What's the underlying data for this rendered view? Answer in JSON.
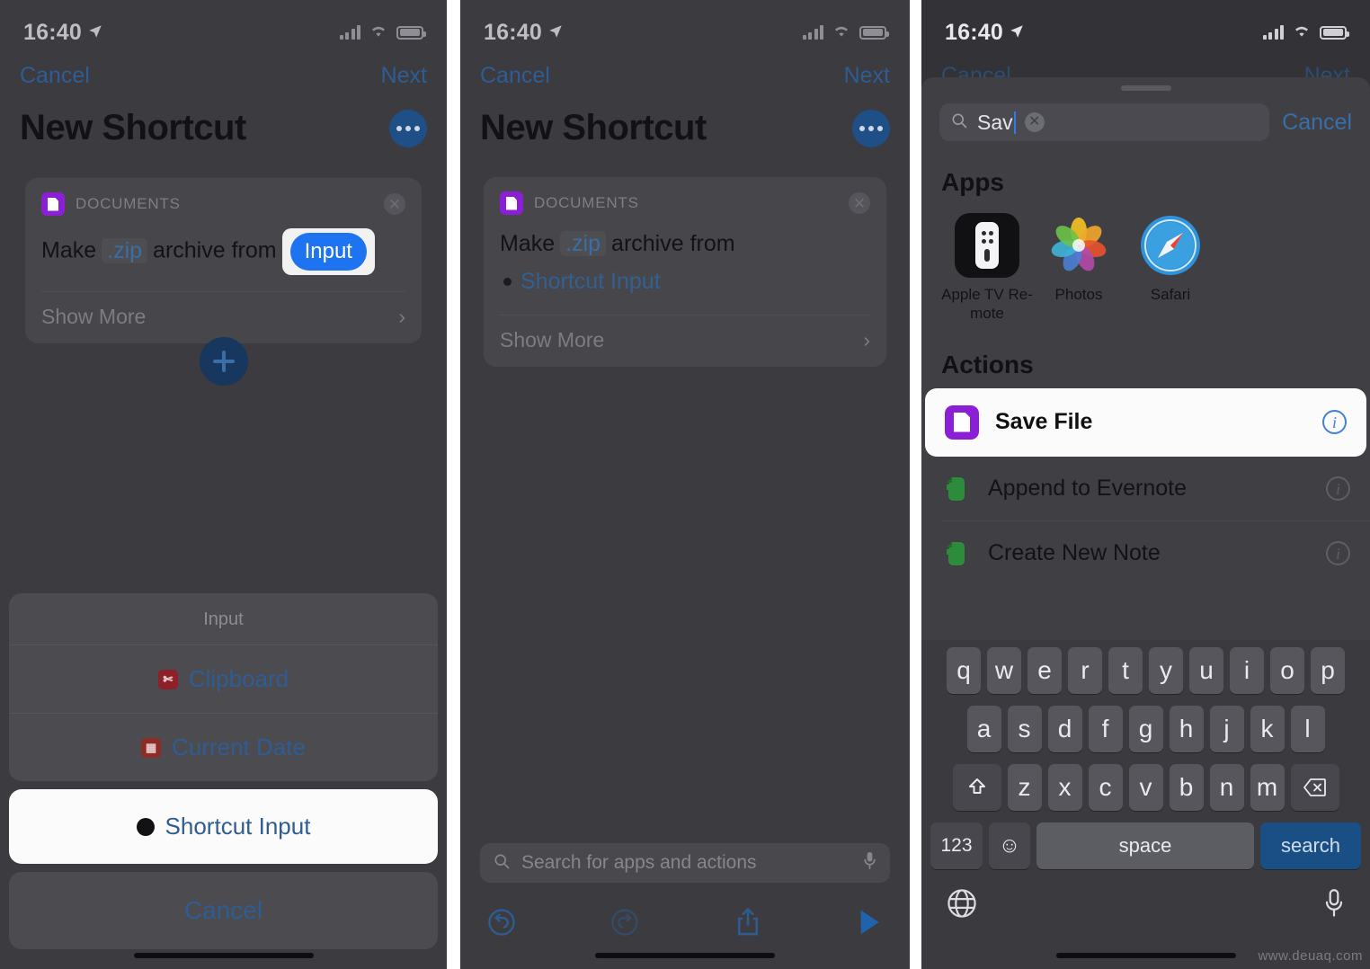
{
  "status_bar": {
    "time": "16:40",
    "location_icon": "location-arrow-icon",
    "signal_icon": "cellular-signal-icon",
    "wifi_icon": "wifi-icon",
    "battery_icon": "battery-icon"
  },
  "panel1": {
    "nav": {
      "cancel": "Cancel",
      "next": "Next"
    },
    "title": "New Shortcut",
    "more_button": "more-options-icon",
    "card": {
      "category": "DOCUMENTS",
      "icon": "documents-app-icon",
      "remove": "✕",
      "text_prefix": "Make",
      "token_zip": ".zip",
      "text_middle": "archive from",
      "token_input": "Input",
      "show_more": "Show More",
      "chevron": "›"
    },
    "add_button": "add-action-button",
    "sheet": {
      "title": "Input",
      "items": [
        {
          "label": "Clipboard",
          "icon": "clipboard-icon"
        },
        {
          "label": "Current Date",
          "icon": "calendar-icon"
        }
      ],
      "highlighted": {
        "label": "Shortcut Input",
        "icon": "shortcut-input-icon"
      },
      "cancel": "Cancel"
    }
  },
  "panel2": {
    "nav": {
      "cancel": "Cancel",
      "next": "Next"
    },
    "title": "New Shortcut",
    "more_button": "more-options-icon",
    "card": {
      "category": "DOCUMENTS",
      "icon": "documents-app-icon",
      "remove": "✕",
      "text_prefix": "Make",
      "token_zip": ".zip",
      "text_middle": "archive from",
      "variable": "Shortcut Input",
      "show_more": "Show More",
      "chevron": "›"
    },
    "add_button": "add-action-button",
    "search": {
      "placeholder": "Search for apps and actions",
      "search_icon": "search-icon",
      "mic_icon": "microphone-icon"
    },
    "toolbar": [
      {
        "name": "undo-button",
        "icon": "undo-icon"
      },
      {
        "name": "redo-button",
        "icon": "redo-icon"
      },
      {
        "name": "share-button",
        "icon": "share-icon"
      },
      {
        "name": "play-button",
        "icon": "play-icon"
      }
    ]
  },
  "panel3": {
    "ghost_nav": {
      "cancel": "Cancel",
      "next": "Next"
    },
    "search": {
      "value": "Sav",
      "clear_label": "✕",
      "cancel": "Cancel",
      "search_icon": "search-icon"
    },
    "apps_heading": "Apps",
    "apps": [
      {
        "label": "Apple TV Re-\nmote",
        "label_line1": "Apple TV Re-",
        "label_line2": "mote",
        "icon": "apple-tv-remote-app-icon"
      },
      {
        "label": "Photos",
        "icon": "photos-app-icon"
      },
      {
        "label": "Safari",
        "icon": "safari-app-icon"
      }
    ],
    "actions_heading": "Actions",
    "actions": [
      {
        "label": "Save File",
        "icon": "documents-app-icon",
        "selected": true,
        "info": "i"
      },
      {
        "label": "Append to Evernote",
        "icon": "evernote-app-icon",
        "selected": false,
        "info": "i"
      },
      {
        "label": "Create New Note",
        "icon": "evernote-app-icon",
        "selected": false,
        "info": "i"
      }
    ],
    "keyboard": {
      "row1": [
        "q",
        "w",
        "e",
        "r",
        "t",
        "y",
        "u",
        "i",
        "o",
        "p"
      ],
      "row2": [
        "a",
        "s",
        "d",
        "f",
        "g",
        "h",
        "j",
        "k",
        "l"
      ],
      "row3": [
        "z",
        "x",
        "c",
        "v",
        "b",
        "n",
        "m"
      ],
      "shift": "shift-icon",
      "backspace": "backspace-icon",
      "numbers": "123",
      "emoji": "emoji-icon",
      "space": "space",
      "search": "search",
      "globe": "globe-icon",
      "dictation": "microphone-icon"
    }
  },
  "watermark": "www.deuaq.com",
  "colors": {
    "background": "#3b3b40",
    "card": "#46464b",
    "accent_blue": "#0b84ff",
    "dim_blue": "#2f5d93",
    "purple": "#8b1fd6",
    "evernote_green": "#2c8c3c",
    "keyboard_bg": "#3a3a3f",
    "key": "#56565c",
    "search_key": "#1a4f86"
  }
}
